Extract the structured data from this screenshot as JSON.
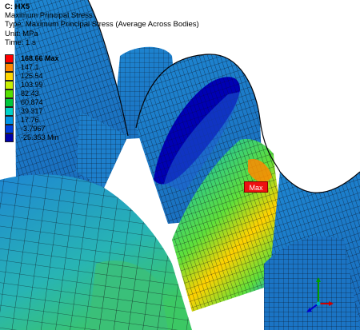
{
  "info": {
    "title": "C: HX5",
    "result_name": "Maximum Principal Stress",
    "type_line": "Type: Maximum Principal Stress (Average Across Bodies)",
    "unit_line": "Unit: MPa",
    "time_line": "Time: 1 s"
  },
  "legend": {
    "entries": [
      {
        "label": "168.66 Max",
        "color": "#ff0000"
      },
      {
        "label": "147.1",
        "color": "#ff8800"
      },
      {
        "label": "125.54",
        "color": "#ffd700"
      },
      {
        "label": "103.99",
        "color": "#c8f000"
      },
      {
        "label": "82.43",
        "color": "#55e000"
      },
      {
        "label": "60.874",
        "color": "#00c83c"
      },
      {
        "label": "39.317",
        "color": "#00d2c8"
      },
      {
        "label": "17.76",
        "color": "#0096e6"
      },
      {
        "label": "-3.7967",
        "color": "#0040e0"
      },
      {
        "label": "-25.353 Min",
        "color": "#0000aa"
      }
    ]
  },
  "probe": {
    "label": "Max"
  },
  "colors": {
    "low_stress": "#0000b4",
    "base_stress": "#1e87d2",
    "mid_stress": "#2cc88c",
    "high_stress": "#ffd200",
    "peak_stress": "#ff0000",
    "mesh_line": "#0a0a14"
  }
}
